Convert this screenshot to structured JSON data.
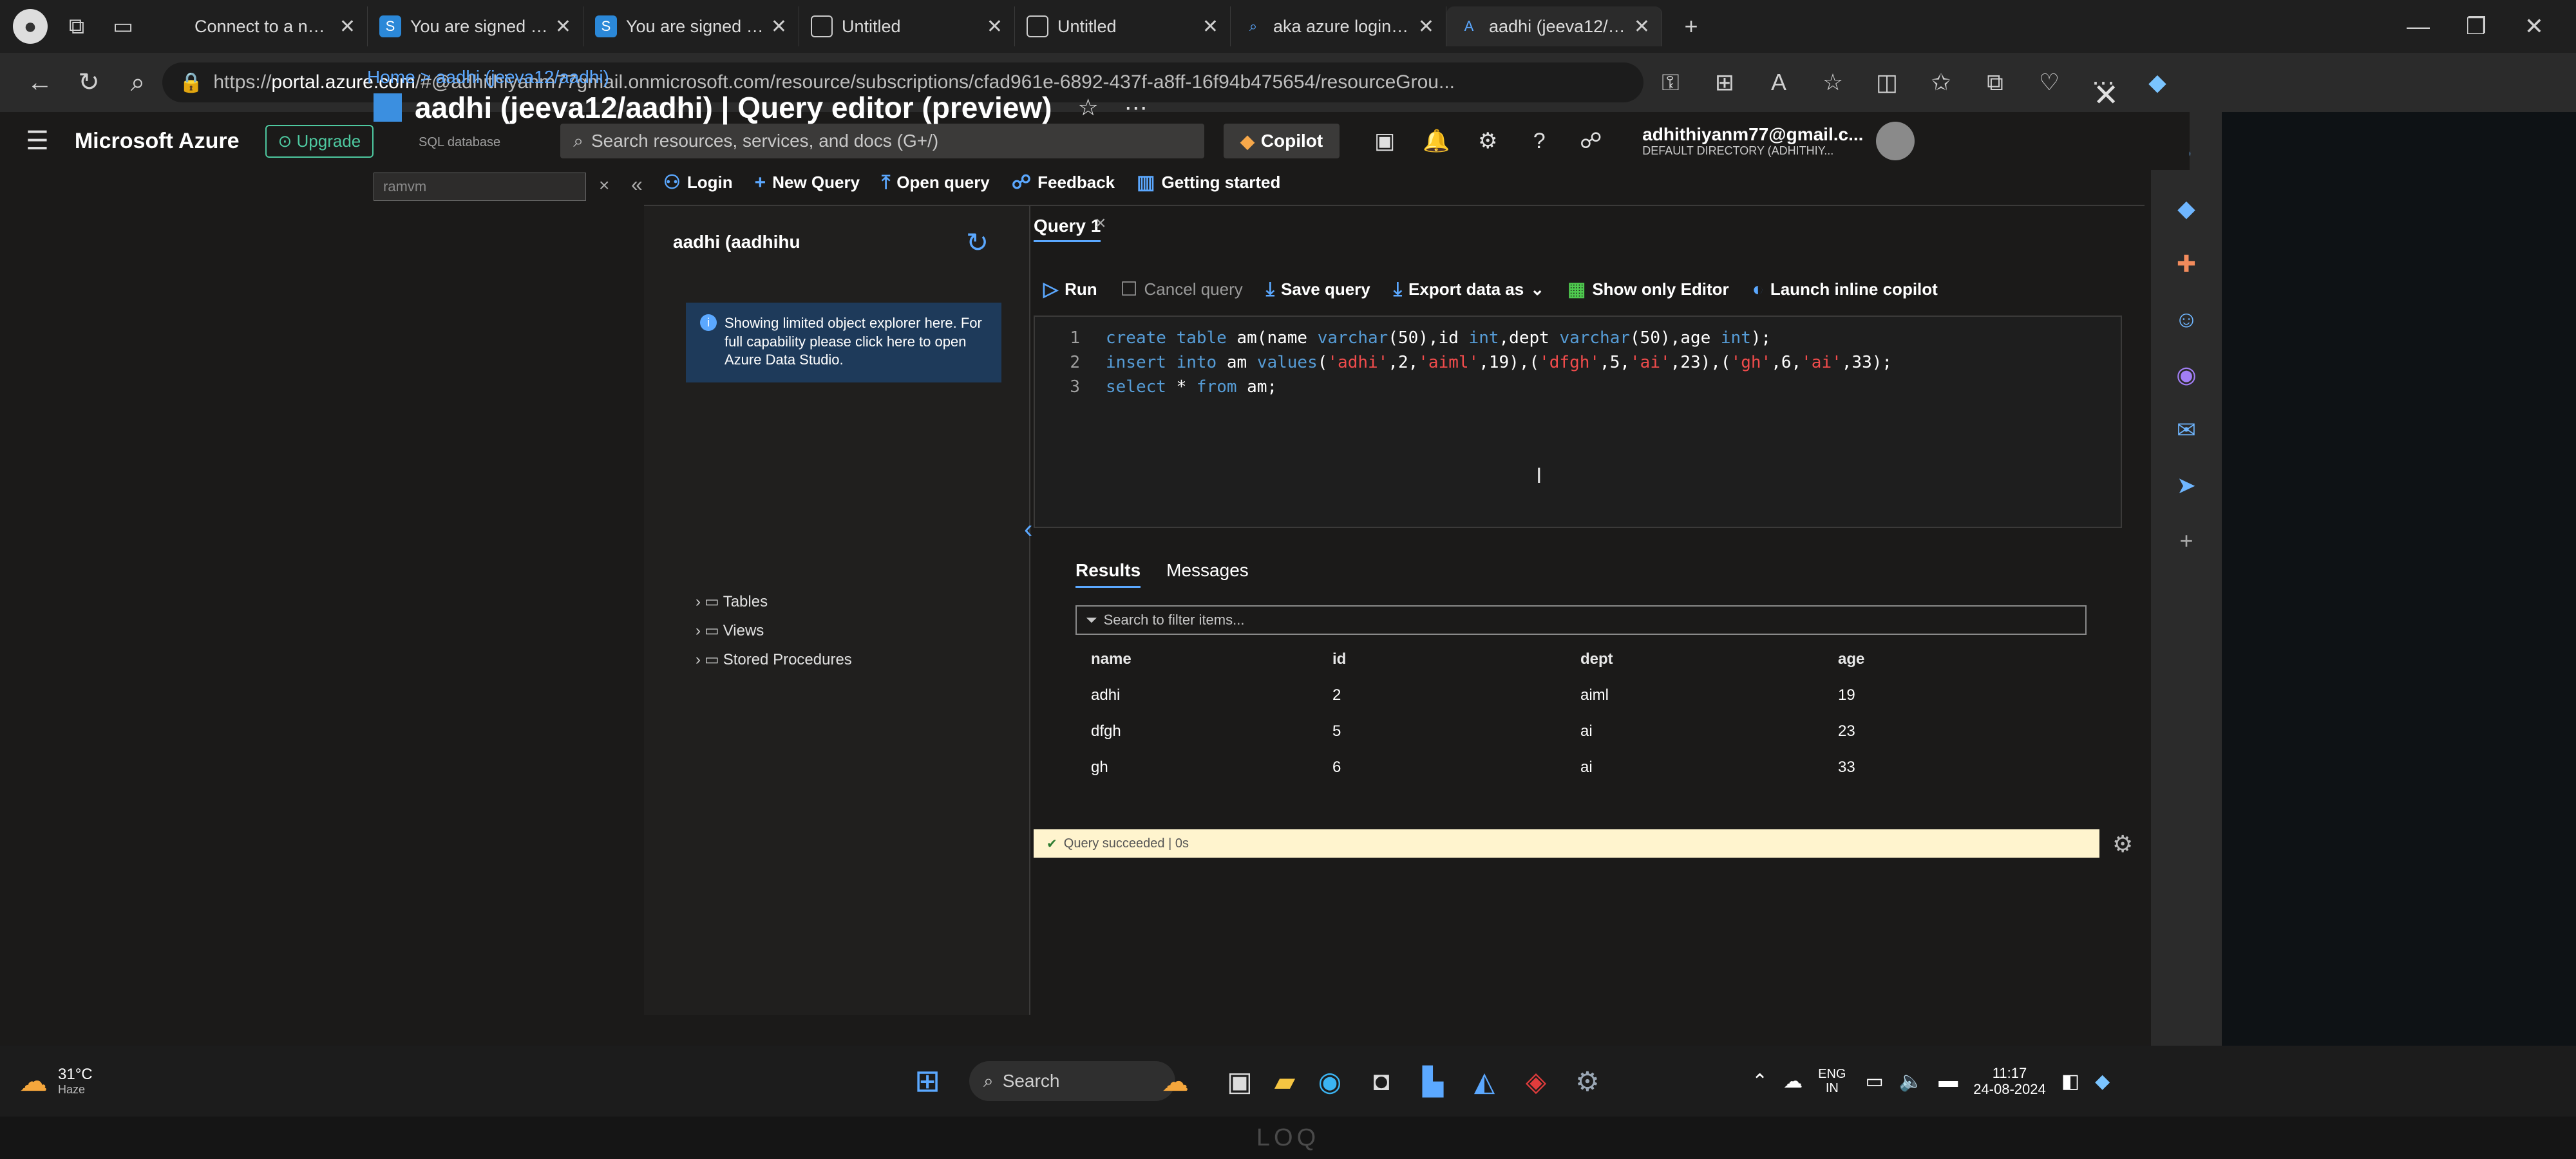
{
  "browser": {
    "tabs": [
      {
        "icon": "wifi-icon",
        "title": "Connect to a network"
      },
      {
        "icon": "sharepoint-icon",
        "title": "You are signed in as"
      },
      {
        "icon": "sharepoint-icon",
        "title": "You are signed in as"
      },
      {
        "icon": "page-icon",
        "title": "Untitled"
      },
      {
        "icon": "page-icon",
        "title": "Untitled"
      },
      {
        "icon": "search-icon",
        "title": "aka azure login - Se"
      },
      {
        "icon": "azure-icon",
        "title": "aadhi (jeeva12/aadhi"
      }
    ],
    "new_tab": "+",
    "url_prefix": "https://",
    "url_host": "portal.azure.com",
    "url_path": "/#@adhithiyanm77gmail.onmicrosoft.com/resource/subscriptions/cfad961e-6892-437f-a8ff-16f94b475654/resourceGrou..."
  },
  "azure": {
    "brand": "Microsoft Azure",
    "upgrade": "Upgrade",
    "search_placeholder": "Search resources, services, and docs (G+/)",
    "copilot": "Copilot",
    "user_email": "adhithiyanm77@gmail.c...",
    "user_directory": "DEFAULT DIRECTORY (ADHITHIY..."
  },
  "breadcrumb": {
    "home": "Home",
    "sep": ">",
    "current": "aadhi (jeeva12/aadhi)"
  },
  "page": {
    "title": "aadhi (jeeva12/aadhi) | Query editor (preview)",
    "subtitle": "SQL database",
    "left_search": "ramvm"
  },
  "toolbar": {
    "login": "Login",
    "new_query": "New Query",
    "open_query": "Open query",
    "feedback": "Feedback",
    "getting_started": "Getting started"
  },
  "object_explorer": {
    "db_name": "aadhi (aadhihu",
    "info": "Showing limited object explorer here. For full capability please click here to open Azure Data Studio.",
    "nodes": [
      "Tables",
      "Views",
      "Stored Procedures"
    ]
  },
  "query": {
    "tab": "Query 1",
    "run": "Run",
    "cancel": "Cancel query",
    "save": "Save query",
    "export": "Export data as",
    "show_editor": "Show only Editor",
    "copilot": "Launch inline copilot",
    "line_numbers": [
      "1",
      "2",
      "3"
    ]
  },
  "results": {
    "tab_results": "Results",
    "tab_messages": "Messages",
    "filter_placeholder": "Search to filter items...",
    "columns": [
      "name",
      "id",
      "dept",
      "age"
    ],
    "rows": [
      [
        "adhi",
        "2",
        "aiml",
        "19"
      ],
      [
        "dfgh",
        "5",
        "ai",
        "23"
      ],
      [
        "gh",
        "6",
        "ai",
        "33"
      ]
    ],
    "status": "Query succeeded | 0s"
  },
  "taskbar": {
    "temp": "31°C",
    "weather": "Haze",
    "search": "Search",
    "lang1": "ENG",
    "lang2": "IN",
    "time": "11:17",
    "date": "24-08-2024"
  },
  "device": {
    "brand": "LOQ"
  },
  "colors": {
    "accent": "#5ba8ff",
    "keyword": "#569cd6",
    "string": "#f14c4c",
    "status_bg": "#fff4ce"
  }
}
